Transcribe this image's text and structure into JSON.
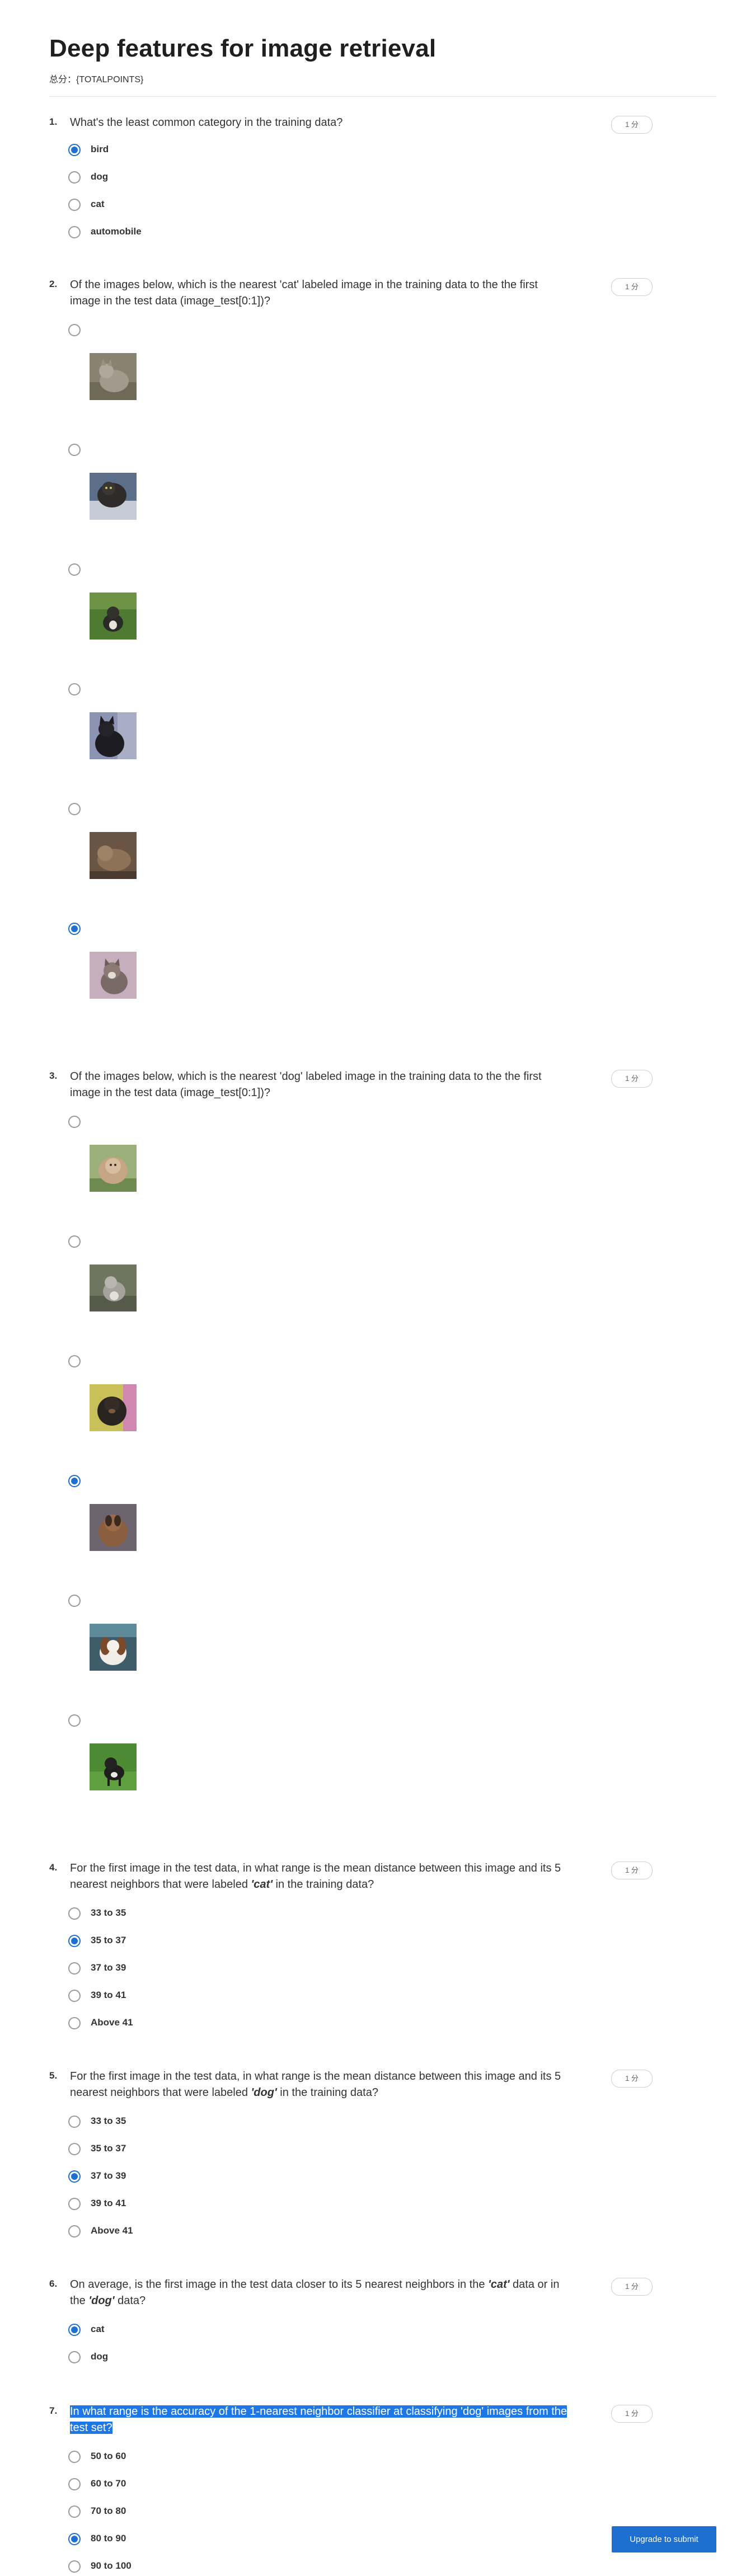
{
  "quiz": {
    "title": "Deep features for image retrieval",
    "total_points": "总分：{TOTALPOINTS}"
  },
  "points_label": "1 分",
  "q1": {
    "number": "1.",
    "text": "What's the least common category in the training data?",
    "options": [
      "bird",
      "dog",
      "cat",
      "automobile"
    ],
    "selected": "bird"
  },
  "q2": {
    "number": "2.",
    "text": "Of the images below, which is the nearest 'cat' labeled image in the training data to the the first image in the test data (image_test[0:1])?",
    "selected_index": 5
  },
  "q3": {
    "number": "3.",
    "text": "Of the images below, which is the nearest 'dog' labeled image in the training data to the the first image in the test data (image_test[0:1])?",
    "selected_index": 3
  },
  "q4": {
    "number": "4.",
    "text_a": "For the first image in the test data, in what range is the mean distance between this image and its 5 nearest neighbors that were labeled ",
    "em": "'cat'",
    "text_b": " in the training data?",
    "options": [
      "33 to 35",
      "35 to 37",
      "37 to 39",
      "39 to 41",
      "Above 41"
    ],
    "selected": "35 to 37"
  },
  "q5": {
    "number": "5.",
    "text_a": "For the first image in the test data, in what range is the mean distance between this image and its 5 nearest neighbors that were labeled ",
    "em": "'dog'",
    "text_b": " in the training data?",
    "options": [
      "33 to 35",
      "35 to 37",
      "37 to 39",
      "39 to 41",
      "Above 41"
    ],
    "selected": "37 to 39"
  },
  "q6": {
    "number": "6.",
    "text_a": "On average, is the first image in the test data closer to its 5 nearest neighbors in the ",
    "em1": "'cat'",
    "text_b": " data or in the ",
    "em2": "'dog'",
    "text_c": " data?",
    "options": [
      "cat",
      "dog"
    ],
    "selected": "cat"
  },
  "q7": {
    "number": "7.",
    "text": "In what range is the accuracy of the 1-nearest neighbor classifier at classifying 'dog' images from the test set?",
    "options": [
      "50 to 60",
      "60 to 70",
      "70 to 80",
      "80 to 90",
      "90 to 100"
    ],
    "selected": "80 to 90"
  },
  "upgrade_button": "Upgrade to submit",
  "colors": {
    "accent": "#1f6fd1",
    "highlight": "#1e77e6"
  },
  "thumbs": {
    "q2": [
      "cat-gray-thumbnail",
      "cat-dark-thumbnail",
      "cat-grass-thumbnail",
      "cat-black-thumbnail",
      "cat-brown-thumbnail",
      "cat-tabby-thumbnail"
    ],
    "q3": [
      "dog-fluffy-thumbnail",
      "dog-gray-thumbnail",
      "dog-black-thumbnail",
      "dog-brown-thumbnail",
      "dog-spaniel-thumbnail",
      "dog-grass-thumbnail"
    ]
  }
}
